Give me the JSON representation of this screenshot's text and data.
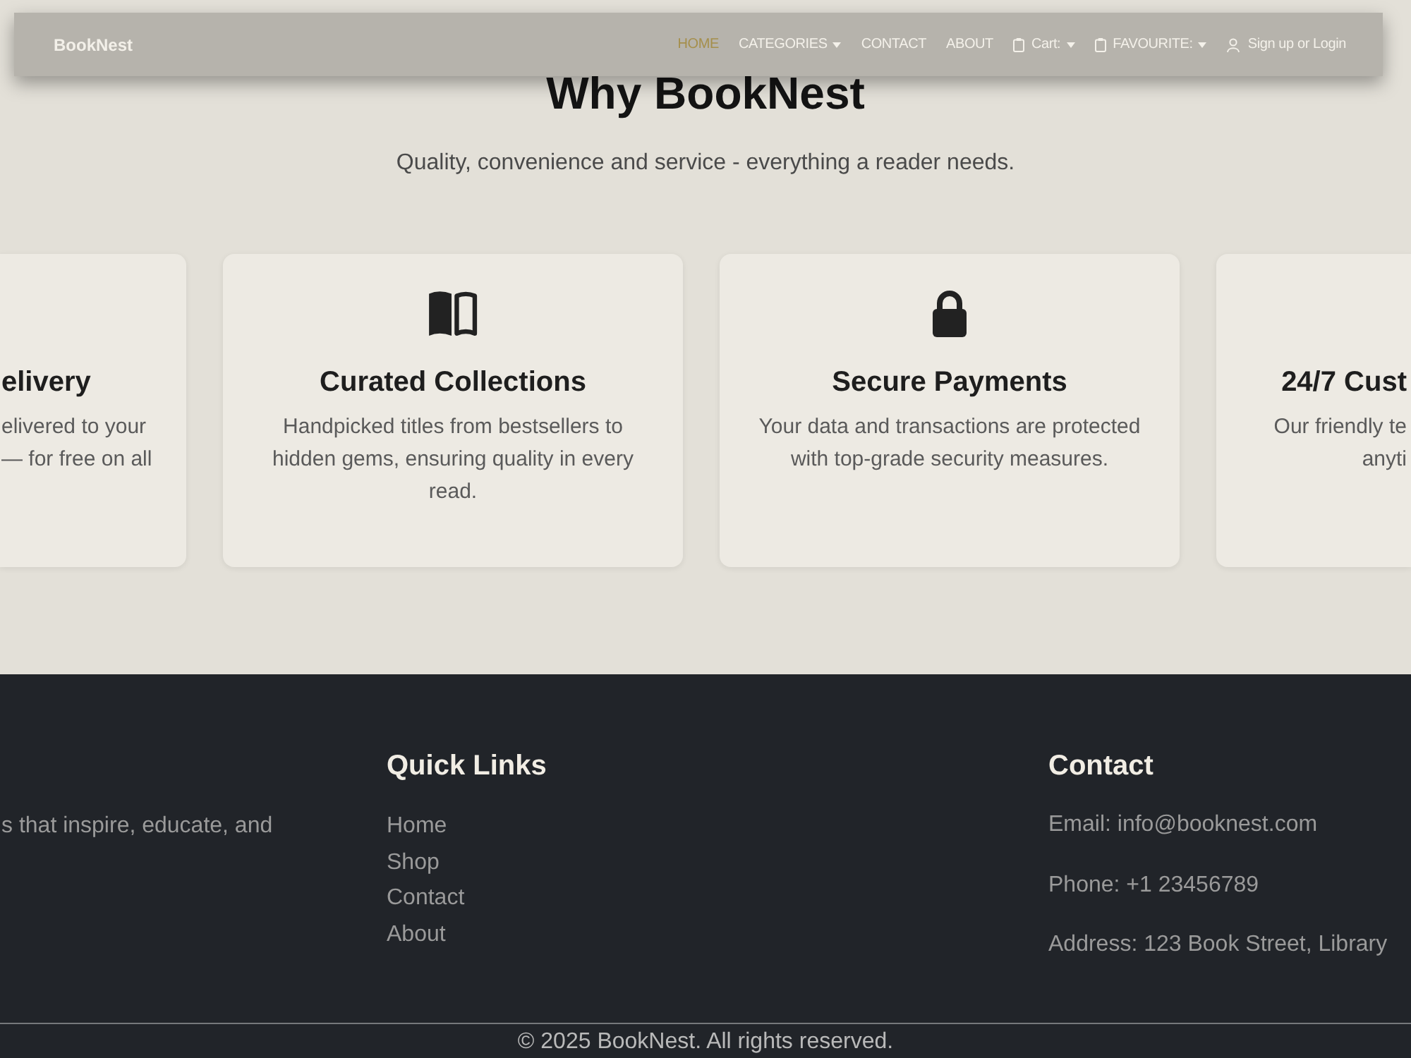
{
  "navbar": {
    "brand": "BookNest",
    "items": [
      {
        "label": "HOME",
        "kind": "link",
        "selected": true
      },
      {
        "label": "CATEGORIES",
        "kind": "menu",
        "selected": false
      },
      {
        "label": "CONTACT",
        "kind": "link",
        "selected": false
      },
      {
        "label": "ABOUT",
        "kind": "link",
        "selected": false
      },
      {
        "label": "Cart:",
        "kind": "clipmenu",
        "selected": false
      },
      {
        "label": "FAVOURITE:",
        "kind": "clipmenu",
        "selected": false
      },
      {
        "label": "Sign up or Login",
        "kind": "account",
        "selected": false
      }
    ]
  },
  "intro": {
    "title": "Why BookNest",
    "subtitle": "Quality, convenience and service - everything a reader needs."
  },
  "features": [
    {
      "kind": "cutleft",
      "title": "elivery",
      "text": [
        "elivered to your",
        "— for free on all"
      ]
    },
    {
      "kind": "full",
      "title": "Curated Collections",
      "text": [
        "Handpicked titles from bestsellers to hidden gems, ensuring quality in every read."
      ]
    },
    {
      "kind": "full",
      "title": "Secure Payments",
      "text": [
        "Your data and transactions are protected with top-grade security measures."
      ]
    },
    {
      "kind": "cutright",
      "title": "24/7 Cust",
      "text": [
        "Our friendly te",
        "anyti"
      ]
    }
  ],
  "footer": {
    "about": "s that inspire, educate, and",
    "quick_links": {
      "title": "Quick Links",
      "items": [
        "Home",
        "Shop",
        "Contact",
        "About"
      ]
    },
    "contact": {
      "title": "Contact",
      "lines": [
        "Email: info@booknest.com",
        "Phone: +1 23456789",
        "Address: 123 Book Street, Library"
      ]
    },
    "copyright": "© 2025 BookNest. All rights reserved."
  }
}
